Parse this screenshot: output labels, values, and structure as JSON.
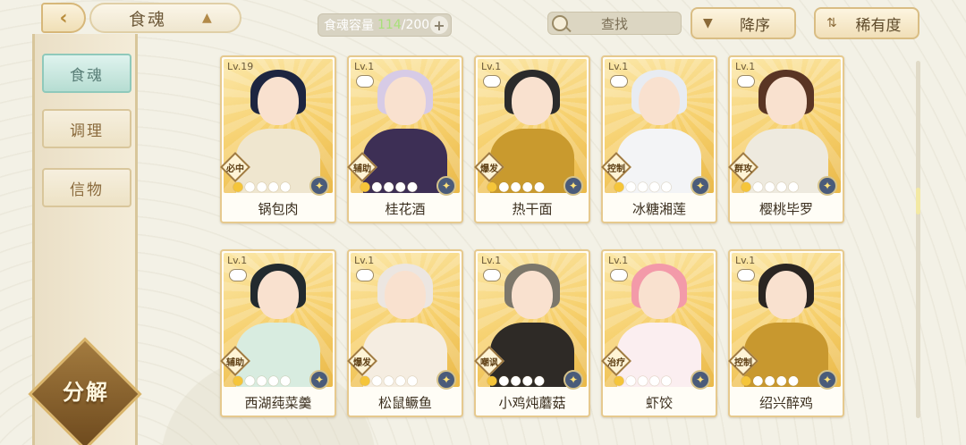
{
  "header": {
    "back_icon": "back-arrow-icon",
    "title": "食魂",
    "capacity_label": "食魂容量",
    "capacity_current": "114",
    "capacity_max": "/200",
    "capacity_add": "+",
    "search_label": "查找",
    "sort_order_label": "降序",
    "sort_by_label": "稀有度"
  },
  "sidebar": {
    "tabs": [
      {
        "label": "食魂"
      },
      {
        "label": "调理"
      },
      {
        "label": "信物"
      }
    ],
    "decompose_label": "分解"
  },
  "colors": {
    "accent_gold": "#e6c98e",
    "active_tab": "#b6ddd2",
    "capacity_current": "#a8e07a"
  },
  "cards": [
    {
      "level": "Lv.19",
      "role": "必中",
      "stars": 1,
      "name": "锅包肉",
      "hair": "#1d2540",
      "outfit": "#efe6cf"
    },
    {
      "level": "Lv.1",
      "role": "辅助",
      "stars": 1,
      "name": "桂花酒",
      "hair": "#d7cbe6",
      "outfit": "#3d2f55"
    },
    {
      "level": "Lv.1",
      "role": "爆发",
      "stars": 1,
      "name": "热干面",
      "hair": "#2b2b2b",
      "outfit": "#c99a2e"
    },
    {
      "level": "Lv.1",
      "role": "控制",
      "stars": 1,
      "name": "冰糖湘莲",
      "hair": "#e8ecf2",
      "outfit": "#f3f4f6"
    },
    {
      "level": "Lv.1",
      "role": "群攻",
      "stars": 1,
      "name": "樱桃毕罗",
      "hair": "#5a3524",
      "outfit": "#eeeadf"
    },
    {
      "level": "Lv.1",
      "role": "辅助",
      "stars": 1,
      "name": "西湖莼菜羹",
      "hair": "#222a2e",
      "outfit": "#d8ece0"
    },
    {
      "level": "Lv.1",
      "role": "爆发",
      "stars": 1,
      "name": "松鼠鳜鱼",
      "hair": "#ece6e1",
      "outfit": "#f5ede1"
    },
    {
      "level": "Lv.1",
      "role": "嘲讽",
      "stars": 1,
      "name": "小鸡炖蘑菇",
      "hair": "#7c776b",
      "outfit": "#2e2a26"
    },
    {
      "level": "Lv.1",
      "role": "治疗",
      "stars": 1,
      "name": "虾饺",
      "hair": "#f39aa9",
      "outfit": "#fbeef0"
    },
    {
      "level": "Lv.1",
      "role": "控制",
      "stars": 1,
      "name": "绍兴醉鸡",
      "hair": "#2a2522",
      "outfit": "#c8982f"
    }
  ]
}
